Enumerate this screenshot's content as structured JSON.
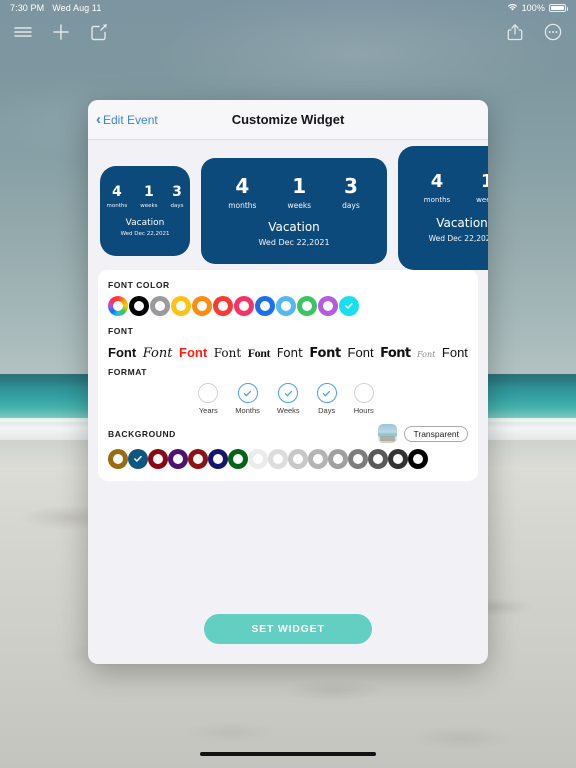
{
  "status_bar": {
    "time": "7:30 PM",
    "date": "Wed Aug 11",
    "battery_percent": "100%",
    "wifi_icon": "wifi-icon",
    "battery_icon": "battery-full-icon"
  },
  "top_toolbar": {
    "left_icons": [
      {
        "name": "hamburger-menu-icon",
        "label": "Menu"
      },
      {
        "name": "plus-icon",
        "label": "Add"
      },
      {
        "name": "compose-icon",
        "label": "Compose"
      }
    ],
    "right_icons": [
      {
        "name": "share-icon",
        "label": "Share"
      },
      {
        "name": "more-options-icon",
        "label": "More"
      }
    ]
  },
  "modal": {
    "back_label": "Edit Event",
    "back_chevron": "‹",
    "title": "Customize Widget"
  },
  "widget_preview": {
    "background_color": "#0d4a7c",
    "text_color": "#ffffff",
    "event_title": "Vacation",
    "event_date": "Wed Dec 22,2021",
    "units": [
      {
        "value": "4",
        "label": "months"
      },
      {
        "value": "1",
        "label": "weeks"
      },
      {
        "value": "3",
        "label": "days"
      }
    ],
    "cards": [
      {
        "size": "small",
        "units_shown": 3
      },
      {
        "size": "medium",
        "units_shown": 3
      },
      {
        "size": "large",
        "units_shown": 2
      }
    ]
  },
  "font_color": {
    "label": "FONT COLOR",
    "selected_index": 11,
    "swatches": [
      {
        "name": "rainbow",
        "color": "rainbow"
      },
      {
        "name": "black",
        "color": "#000000"
      },
      {
        "name": "gray",
        "color": "#9a9a9e"
      },
      {
        "name": "yellow",
        "color": "#fdc212"
      },
      {
        "name": "orange",
        "color": "#fb8c14"
      },
      {
        "name": "red",
        "color": "#f73b34"
      },
      {
        "name": "pink",
        "color": "#f43366"
      },
      {
        "name": "blue",
        "color": "#1b6ff0"
      },
      {
        "name": "light-blue",
        "color": "#55b9f0"
      },
      {
        "name": "green",
        "color": "#3bc562"
      },
      {
        "name": "purple",
        "color": "#b65ae0"
      },
      {
        "name": "cyan",
        "color": "#19dff0"
      }
    ]
  },
  "font": {
    "label": "FONT",
    "selected_index": 2,
    "samples": [
      "Font",
      "Font",
      "Font",
      "Font",
      "Font",
      "Font",
      "Font",
      "Font",
      "Font",
      "Font",
      "Font"
    ]
  },
  "format": {
    "label": "FORMAT",
    "options": [
      {
        "label": "Years",
        "checked": false
      },
      {
        "label": "Months",
        "checked": true
      },
      {
        "label": "Weeks",
        "checked": true
      },
      {
        "label": "Days",
        "checked": true
      },
      {
        "label": "Hours",
        "checked": false
      }
    ]
  },
  "background": {
    "label": "BACKGROUND",
    "transparent_label": "Transparent",
    "image_thumb_name": "background-image-thumbnail",
    "selected_index": 1,
    "swatches": [
      {
        "name": "bronze",
        "color": "#9a6b10"
      },
      {
        "name": "ocean-blue",
        "color": "#0d5680"
      },
      {
        "name": "dark-red",
        "color": "#8d0613"
      },
      {
        "name": "purple",
        "color": "#4a1472"
      },
      {
        "name": "maroon",
        "color": "#8d1414"
      },
      {
        "name": "navy",
        "color": "#151470"
      },
      {
        "name": "dark-green",
        "color": "#046317"
      },
      {
        "name": "gray-1",
        "color": "#ebebeb"
      },
      {
        "name": "gray-2",
        "color": "#dcdcdc"
      },
      {
        "name": "gray-3",
        "color": "#c8c8c8"
      },
      {
        "name": "gray-4",
        "color": "#b4b4b4"
      },
      {
        "name": "gray-5",
        "color": "#a0a0a0"
      },
      {
        "name": "gray-6",
        "color": "#7d7d7d"
      },
      {
        "name": "gray-7",
        "color": "#5a5a5a"
      },
      {
        "name": "gray-8",
        "color": "#333333"
      },
      {
        "name": "black",
        "color": "#000000"
      }
    ]
  },
  "set_widget": {
    "label": "SET WIDGET",
    "color": "#63cec2"
  }
}
